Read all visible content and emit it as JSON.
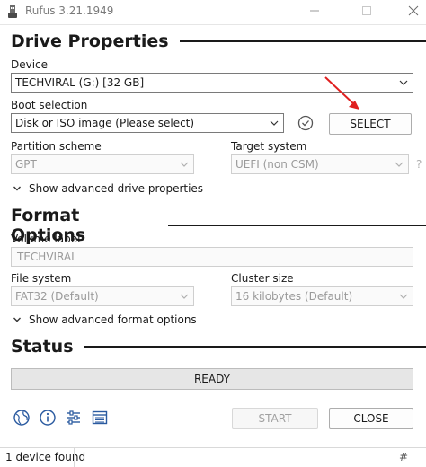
{
  "window": {
    "title": "Rufus 3.21.1949"
  },
  "drive_properties": {
    "header": "Drive Properties",
    "device_label": "Device",
    "device_value": "TECHVIRAL (G:) [32 GB]",
    "boot_label": "Boot selection",
    "boot_value": "Disk or ISO image (Please select)",
    "select_button": "SELECT",
    "partition_label": "Partition scheme",
    "partition_value": "GPT",
    "target_label": "Target system",
    "target_value": "UEFI (non CSM)",
    "target_help": "?",
    "advanced_toggle": "Show advanced drive properties"
  },
  "format_options": {
    "header": "Format Options",
    "volume_label": "Volume label",
    "volume_value": "TECHVIRAL",
    "fs_label": "File system",
    "fs_value": "FAT32 (Default)",
    "cluster_label": "Cluster size",
    "cluster_value": "16 kilobytes (Default)",
    "advanced_toggle": "Show advanced format options"
  },
  "status": {
    "header": "Status",
    "progress_text": "READY",
    "start_button": "START",
    "close_button": "CLOSE"
  },
  "statusbar": {
    "text": "1 device found",
    "hash": "#"
  },
  "colors": {
    "arrow": "#e02020",
    "accent": "#1a1a1a"
  }
}
